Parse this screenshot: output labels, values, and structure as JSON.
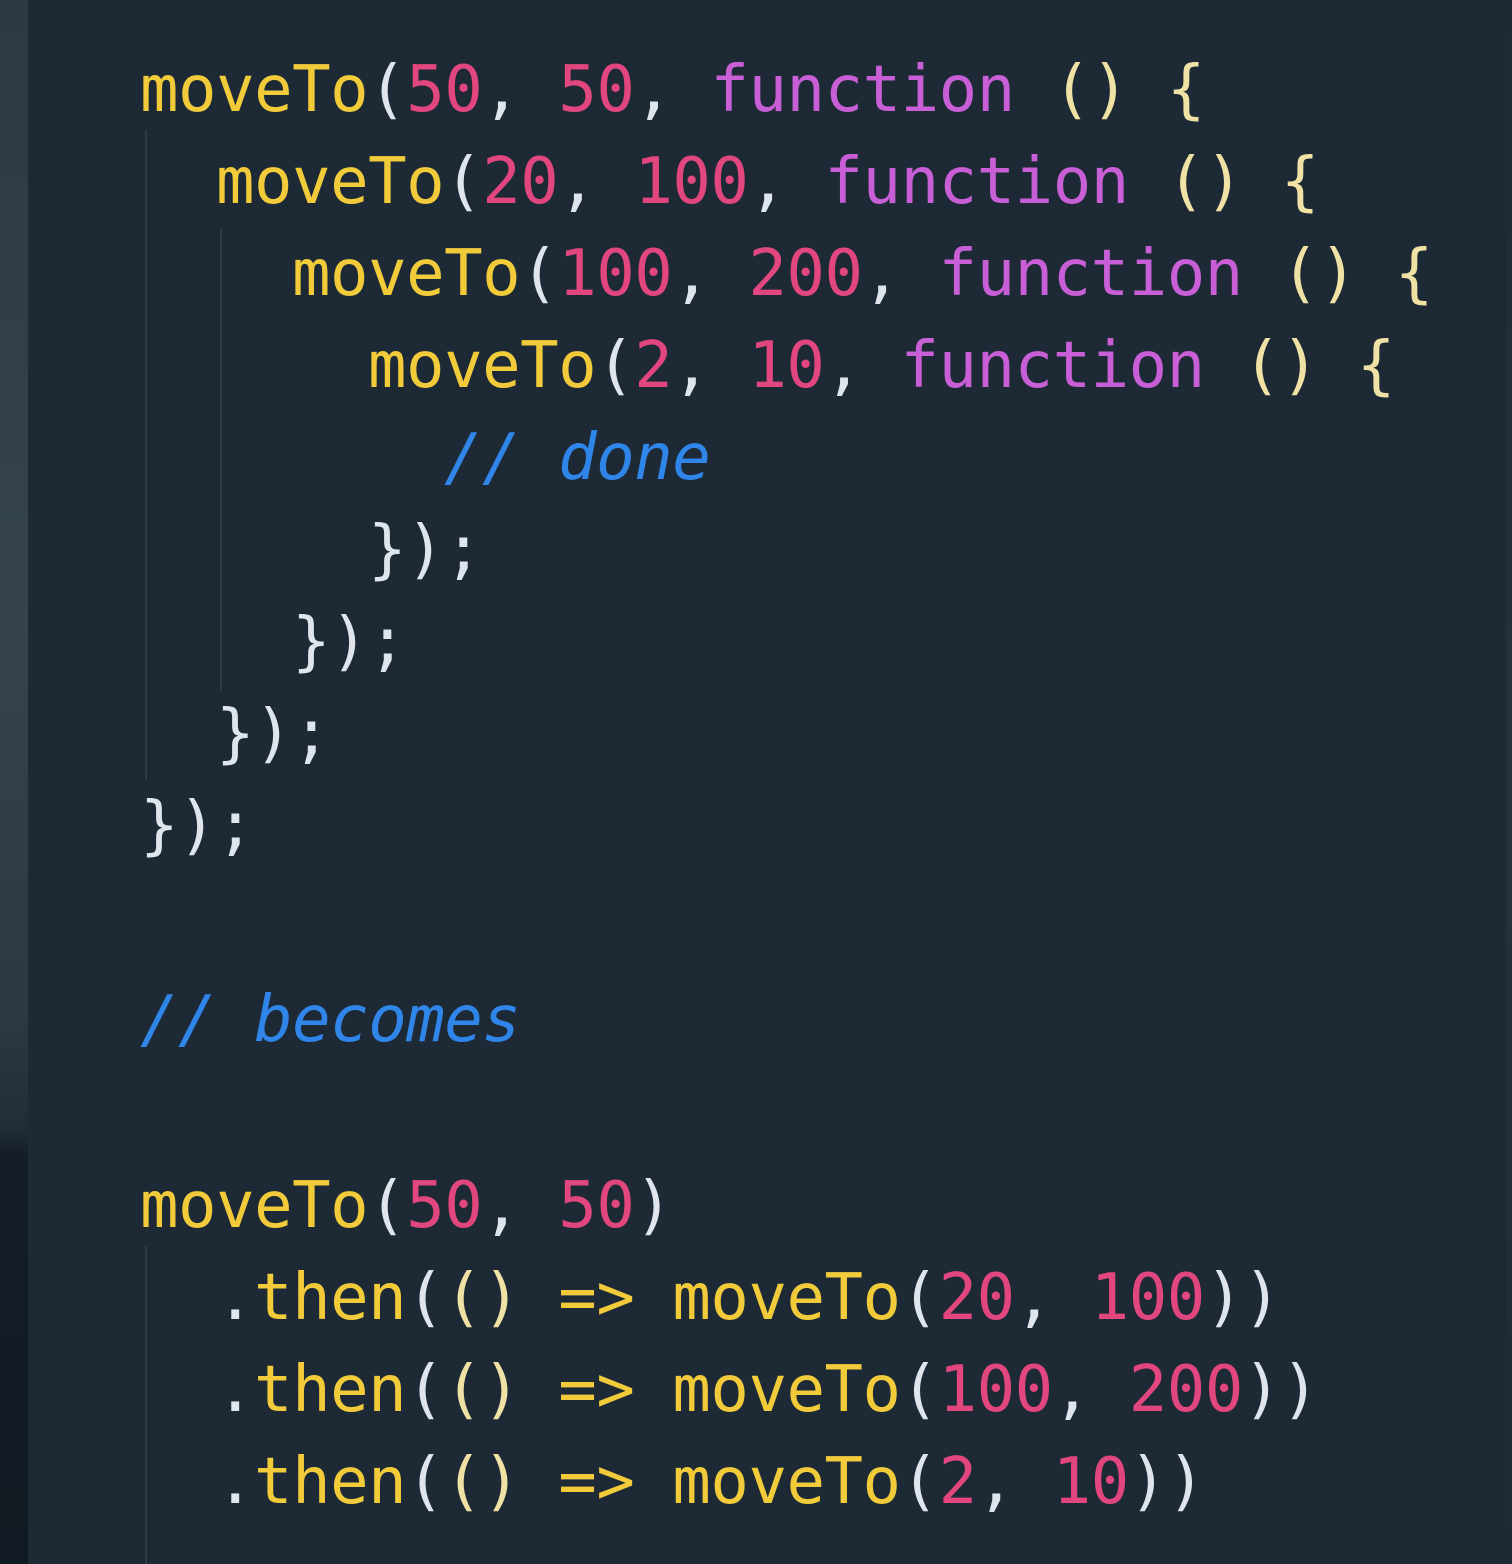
{
  "editor": {
    "nested_block": [
      {
        "indent": 0,
        "tokens": [
          {
            "t": "moveTo",
            "k": "fn"
          },
          {
            "t": "(",
            "k": "pun"
          },
          {
            "t": "50",
            "k": "num"
          },
          {
            "t": ", ",
            "k": "pun"
          },
          {
            "t": "50",
            "k": "num"
          },
          {
            "t": ", ",
            "k": "pun"
          },
          {
            "t": "function",
            "k": "kw"
          },
          {
            "t": " ",
            "k": "pun"
          },
          {
            "t": "()",
            "k": "br"
          },
          {
            "t": " ",
            "k": "pun"
          },
          {
            "t": "{",
            "k": "br"
          }
        ]
      },
      {
        "indent": 1,
        "tokens": [
          {
            "t": "moveTo",
            "k": "fn"
          },
          {
            "t": "(",
            "k": "pun"
          },
          {
            "t": "20",
            "k": "num"
          },
          {
            "t": ", ",
            "k": "pun"
          },
          {
            "t": "100",
            "k": "num"
          },
          {
            "t": ", ",
            "k": "pun"
          },
          {
            "t": "function",
            "k": "kw"
          },
          {
            "t": " ",
            "k": "pun"
          },
          {
            "t": "()",
            "k": "br"
          },
          {
            "t": " ",
            "k": "pun"
          },
          {
            "t": "{",
            "k": "br"
          }
        ]
      },
      {
        "indent": 2,
        "tokens": [
          {
            "t": "moveTo",
            "k": "fn"
          },
          {
            "t": "(",
            "k": "pun"
          },
          {
            "t": "100",
            "k": "num"
          },
          {
            "t": ", ",
            "k": "pun"
          },
          {
            "t": "200",
            "k": "num"
          },
          {
            "t": ", ",
            "k": "pun"
          },
          {
            "t": "function",
            "k": "kw"
          },
          {
            "t": " ",
            "k": "pun"
          },
          {
            "t": "()",
            "k": "br"
          },
          {
            "t": " ",
            "k": "pun"
          },
          {
            "t": "{",
            "k": "br"
          }
        ]
      },
      {
        "indent": 3,
        "tokens": [
          {
            "t": "moveTo",
            "k": "fn"
          },
          {
            "t": "(",
            "k": "pun"
          },
          {
            "t": "2",
            "k": "num"
          },
          {
            "t": ", ",
            "k": "pun"
          },
          {
            "t": "10",
            "k": "num"
          },
          {
            "t": ", ",
            "k": "pun"
          },
          {
            "t": "function",
            "k": "kw"
          },
          {
            "t": " ",
            "k": "pun"
          },
          {
            "t": "()",
            "k": "br"
          },
          {
            "t": " ",
            "k": "pun"
          },
          {
            "t": "{",
            "k": "br"
          }
        ]
      },
      {
        "indent": 4,
        "tokens": [
          {
            "t": "// done",
            "k": "cm"
          }
        ]
      },
      {
        "indent": 3,
        "tokens": [
          {
            "t": "});",
            "k": "pun"
          }
        ]
      },
      {
        "indent": 2,
        "tokens": [
          {
            "t": "});",
            "k": "pun"
          }
        ]
      },
      {
        "indent": 1,
        "tokens": [
          {
            "t": "});",
            "k": "pun"
          }
        ]
      },
      {
        "indent": 0,
        "tokens": [
          {
            "t": "});",
            "k": "pun"
          }
        ]
      }
    ],
    "comment": "// becomes",
    "promise_block": [
      {
        "indent": 0,
        "tokens": [
          {
            "t": "moveTo",
            "k": "fn"
          },
          {
            "t": "(",
            "k": "pun"
          },
          {
            "t": "50",
            "k": "num"
          },
          {
            "t": ", ",
            "k": "pun"
          },
          {
            "t": "50",
            "k": "num"
          },
          {
            "t": ")",
            "k": "pun"
          }
        ]
      },
      {
        "indent": 1,
        "tokens": [
          {
            "t": ".",
            "k": "pun"
          },
          {
            "t": "then",
            "k": "fn"
          },
          {
            "t": "(",
            "k": "pun"
          },
          {
            "t": "()",
            "k": "br"
          },
          {
            "t": " ",
            "k": "pun"
          },
          {
            "t": "=>",
            "k": "arrow"
          },
          {
            "t": " ",
            "k": "pun"
          },
          {
            "t": "moveTo",
            "k": "fn"
          },
          {
            "t": "(",
            "k": "pun"
          },
          {
            "t": "20",
            "k": "num"
          },
          {
            "t": ", ",
            "k": "pun"
          },
          {
            "t": "100",
            "k": "num"
          },
          {
            "t": "))",
            "k": "pun"
          }
        ]
      },
      {
        "indent": 1,
        "tokens": [
          {
            "t": ".",
            "k": "pun"
          },
          {
            "t": "then",
            "k": "fn"
          },
          {
            "t": "(",
            "k": "pun"
          },
          {
            "t": "()",
            "k": "br"
          },
          {
            "t": " ",
            "k": "pun"
          },
          {
            "t": "=>",
            "k": "arrow"
          },
          {
            "t": " ",
            "k": "pun"
          },
          {
            "t": "moveTo",
            "k": "fn"
          },
          {
            "t": "(",
            "k": "pun"
          },
          {
            "t": "100",
            "k": "num"
          },
          {
            "t": ", ",
            "k": "pun"
          },
          {
            "t": "200",
            "k": "num"
          },
          {
            "t": "))",
            "k": "pun"
          }
        ]
      },
      {
        "indent": 1,
        "tokens": [
          {
            "t": ".",
            "k": "pun"
          },
          {
            "t": "then",
            "k": "fn"
          },
          {
            "t": "(",
            "k": "pun"
          },
          {
            "t": "()",
            "k": "br"
          },
          {
            "t": " ",
            "k": "pun"
          },
          {
            "t": "=>",
            "k": "arrow"
          },
          {
            "t": " ",
            "k": "pun"
          },
          {
            "t": "moveTo",
            "k": "fn"
          },
          {
            "t": "(",
            "k": "pun"
          },
          {
            "t": "2",
            "k": "num"
          },
          {
            "t": ", ",
            "k": "pun"
          },
          {
            "t": "10",
            "k": "num"
          },
          {
            "t": "))",
            "k": "pun"
          }
        ]
      }
    ],
    "colors": {
      "background": "#1d2a36",
      "function_name": "#f1cb3a",
      "number": "#e2467f",
      "keyword": "#c95fd6",
      "brace": "#f0e2a4",
      "punctuation": "#dfe5ec",
      "comment": "#2f85e8"
    }
  }
}
